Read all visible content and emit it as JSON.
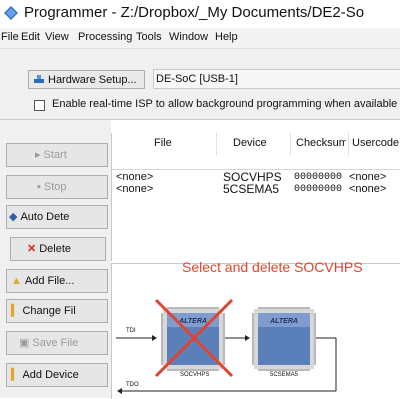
{
  "window": {
    "title": "Programmer - Z:/Dropbox/_My Documents/DE2-So"
  },
  "menu": [
    "File",
    "Edit",
    "View",
    "Processing",
    "Tools",
    "Window",
    "Help"
  ],
  "hardware": {
    "setup_label": "Hardware Setup...",
    "device_name": "DE-SoC [USB-1]",
    "isp_label": "Enable real-time ISP to allow background programming when available"
  },
  "side_buttons": [
    {
      "label": "Start",
      "enabled": false
    },
    {
      "label": "Stop",
      "enabled": false
    },
    {
      "label": "Auto Dete",
      "enabled": true
    },
    {
      "label": "Delete",
      "enabled": true
    },
    {
      "label": "Add File...",
      "enabled": true
    },
    {
      "label": "Change Fil",
      "enabled": true
    },
    {
      "label": "Save File",
      "enabled": false
    },
    {
      "label": "Add Device",
      "enabled": true
    }
  ],
  "table": {
    "headers": [
      "File",
      "Device",
      "Checksum",
      "Usercode"
    ],
    "rows": [
      {
        "file": "<none>",
        "device": "SOCVHPS",
        "checksum": "00000000",
        "usercode": "<none>"
      },
      {
        "file": "<none>",
        "device": "5CSEMA5",
        "checksum": "00000000",
        "usercode": "<none>"
      }
    ]
  },
  "annotation": "Select and delete SOCVHPS",
  "diagram": {
    "chips": [
      "SOCVHPS",
      "5CSEMA5"
    ],
    "tdi": "TDI",
    "tdo": "TDO",
    "chip_logo": "ALTERA"
  },
  "colors": {
    "annotation": "#e0442e",
    "chip_blue": "#5b7fb8"
  }
}
